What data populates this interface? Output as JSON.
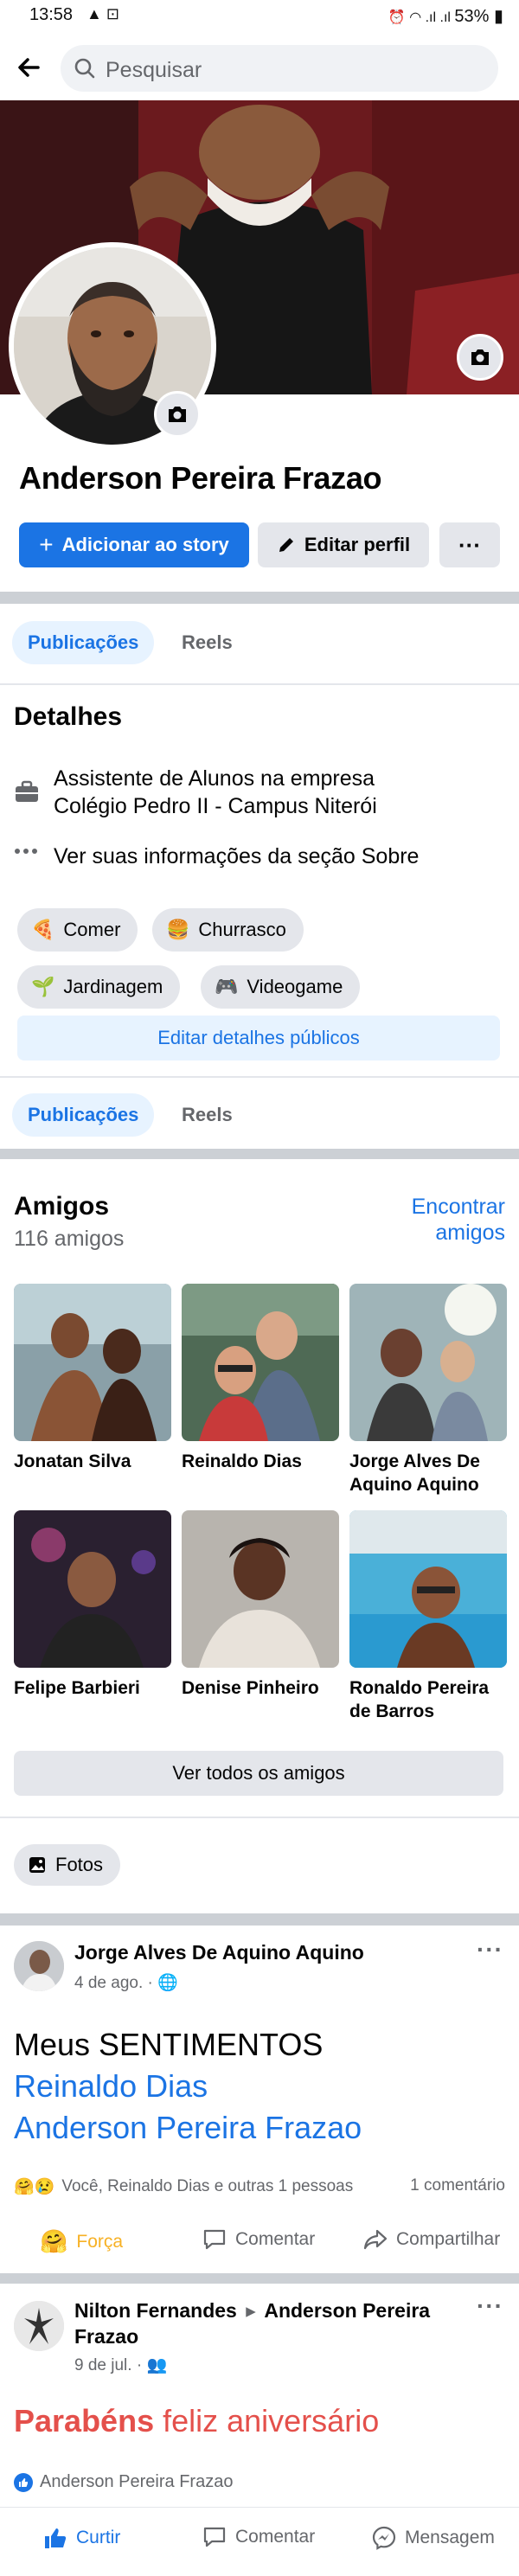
{
  "status_bar": {
    "time": "13:58",
    "battery": "53%"
  },
  "search": {
    "placeholder": "Pesquisar"
  },
  "profile": {
    "name": "Anderson Pereira Frazao",
    "add_story_label": "Adicionar ao story",
    "edit_profile_label": "Editar perfil",
    "more_label": "···"
  },
  "tabs_top": [
    {
      "label": "Publicações"
    },
    {
      "label": "Reels"
    }
  ],
  "details": {
    "title": "Detalhes",
    "job_line1": "Assistente de Alunos na empresa",
    "job_line2": "Colégio Pedro II - Campus Niterói",
    "about_link": "Ver suas informações da seção Sobre",
    "interests": [
      {
        "emoji": "🍕",
        "label": "Comer"
      },
      {
        "emoji": "🍔",
        "label": "Churrasco"
      },
      {
        "emoji": "🌱",
        "label": "Jardinagem"
      },
      {
        "emoji": "🎮",
        "label": "Videogame"
      }
    ],
    "edit_public_label": "Editar detalhes públicos"
  },
  "tabs_bottom": [
    {
      "label": "Publicações"
    },
    {
      "label": "Reels"
    }
  ],
  "friends": {
    "title": "Amigos",
    "count": "116 amigos",
    "find_line1": "Encontrar",
    "find_line2": "amigos",
    "items": [
      {
        "line1": "Jonatan Silva",
        "line2": ""
      },
      {
        "line1": "Reinaldo Dias",
        "line2": ""
      },
      {
        "line1": "Jorge Alves De",
        "line2": "Aquino Aquino"
      },
      {
        "line1": "Felipe Barbieri",
        "line2": ""
      },
      {
        "line1": "Denise Pinheiro",
        "line2": ""
      },
      {
        "line1": "Ronaldo Pereira",
        "line2": "de Barros"
      }
    ],
    "see_all_label": "Ver todos os amigos"
  },
  "photos": {
    "label": "Fotos"
  },
  "post1": {
    "author": "Jorge Alves De Aquino Aquino",
    "date": "4 de ago. ·",
    "text_line1": "Meus SENTIMENTOS",
    "mention1": "Reinaldo Dias",
    "mention2": "Anderson Pereira Frazao",
    "reactions_text": "Você, Reinaldo Dias e outras 1 pessoas",
    "comments_count": "1 comentário",
    "action_react": "Força",
    "action_comment": "Comentar",
    "action_share": "Compartilhar",
    "colors": {
      "react": "#f7b125"
    }
  },
  "post2": {
    "author_line1": "Nilton Fernandes",
    "arrow": "▸",
    "target_line1": "Anderson Pereira",
    "target_line2": "Frazao",
    "date": "9 de jul. ·",
    "text_red": "Parabéns",
    "text_rest": "feliz aniversário",
    "like_name": "Anderson Pereira Frazao",
    "action_like": "Curtir",
    "action_comment": "Comentar",
    "action_message": "Mensagem",
    "colors": {
      "red": "#e4504b",
      "blue": "#1b74e4"
    }
  },
  "colors": {
    "accent": "#1b74e4",
    "divider": "#ccd0d5",
    "chip": "#e4e6eb"
  }
}
